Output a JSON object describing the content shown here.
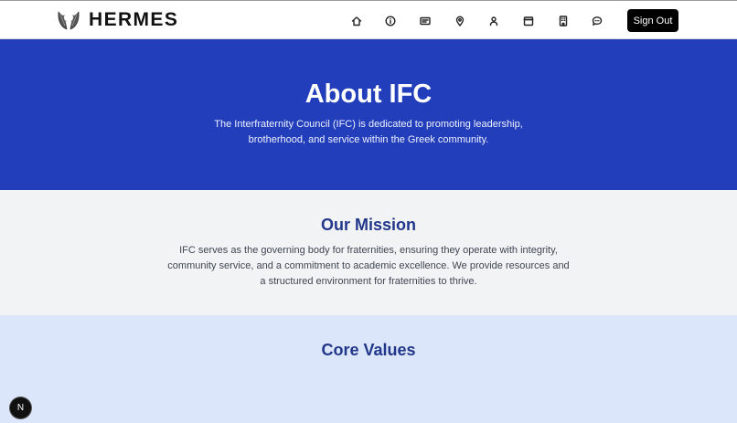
{
  "header": {
    "brand": "HERMES",
    "logo_icon": "wings-icon",
    "nav": [
      {
        "name": "home",
        "icon": "home-icon"
      },
      {
        "name": "about",
        "icon": "info-icon"
      },
      {
        "name": "news",
        "icon": "card-icon"
      },
      {
        "name": "locations",
        "icon": "map-pin-icon"
      },
      {
        "name": "profile",
        "icon": "user-icon"
      },
      {
        "name": "calendar",
        "icon": "calendar-icon"
      },
      {
        "name": "buildings",
        "icon": "building-icon"
      },
      {
        "name": "messages",
        "icon": "chat-icon"
      }
    ],
    "signout_label": "Sign Out"
  },
  "hero": {
    "title": "About IFC",
    "description": "The Interfraternity Council (IFC) is dedicated to promoting leadership, brotherhood, and service within the Greek community."
  },
  "mission": {
    "heading": "Our Mission",
    "text": "IFC serves as the governing body for fraternities, ensuring they operate with integrity, community service, and a commitment to academic excellence. We provide resources and a structured environment for fraternities to thrive."
  },
  "values": {
    "heading": "Core Values"
  },
  "dev_badge": {
    "letter": "N"
  },
  "colors": {
    "hero_bg": "#223ebb",
    "mission_bg": "#f2f3f5",
    "values_bg": "#dbe6fb",
    "heading_blue": "#22378a",
    "button_bg": "#000000"
  }
}
